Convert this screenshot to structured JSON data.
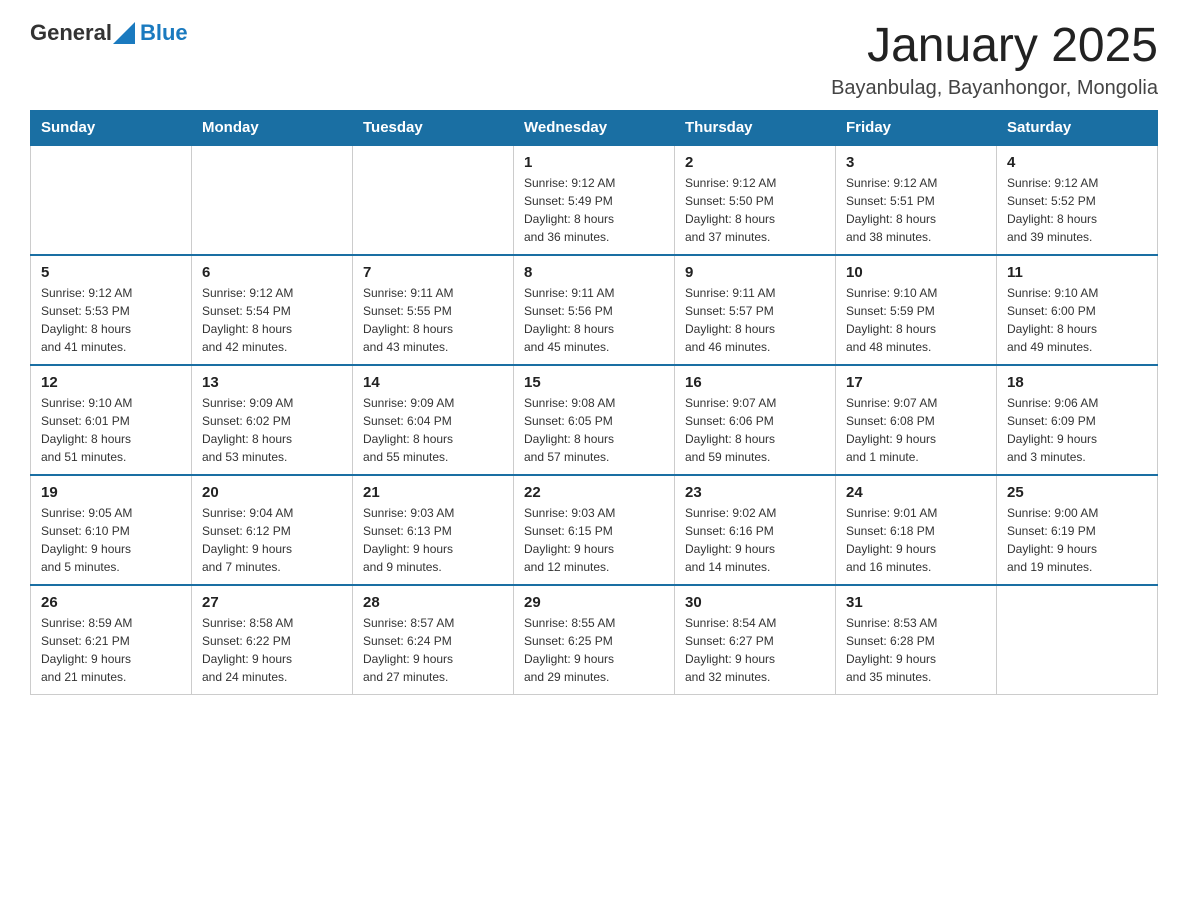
{
  "logo": {
    "text_general": "General",
    "text_blue": "Blue"
  },
  "header": {
    "month_title": "January 2025",
    "location": "Bayanbulag, Bayanhongor, Mongolia"
  },
  "days_of_week": [
    "Sunday",
    "Monday",
    "Tuesday",
    "Wednesday",
    "Thursday",
    "Friday",
    "Saturday"
  ],
  "weeks": [
    [
      {
        "day": "",
        "info": ""
      },
      {
        "day": "",
        "info": ""
      },
      {
        "day": "",
        "info": ""
      },
      {
        "day": "1",
        "info": "Sunrise: 9:12 AM\nSunset: 5:49 PM\nDaylight: 8 hours\nand 36 minutes."
      },
      {
        "day": "2",
        "info": "Sunrise: 9:12 AM\nSunset: 5:50 PM\nDaylight: 8 hours\nand 37 minutes."
      },
      {
        "day": "3",
        "info": "Sunrise: 9:12 AM\nSunset: 5:51 PM\nDaylight: 8 hours\nand 38 minutes."
      },
      {
        "day": "4",
        "info": "Sunrise: 9:12 AM\nSunset: 5:52 PM\nDaylight: 8 hours\nand 39 minutes."
      }
    ],
    [
      {
        "day": "5",
        "info": "Sunrise: 9:12 AM\nSunset: 5:53 PM\nDaylight: 8 hours\nand 41 minutes."
      },
      {
        "day": "6",
        "info": "Sunrise: 9:12 AM\nSunset: 5:54 PM\nDaylight: 8 hours\nand 42 minutes."
      },
      {
        "day": "7",
        "info": "Sunrise: 9:11 AM\nSunset: 5:55 PM\nDaylight: 8 hours\nand 43 minutes."
      },
      {
        "day": "8",
        "info": "Sunrise: 9:11 AM\nSunset: 5:56 PM\nDaylight: 8 hours\nand 45 minutes."
      },
      {
        "day": "9",
        "info": "Sunrise: 9:11 AM\nSunset: 5:57 PM\nDaylight: 8 hours\nand 46 minutes."
      },
      {
        "day": "10",
        "info": "Sunrise: 9:10 AM\nSunset: 5:59 PM\nDaylight: 8 hours\nand 48 minutes."
      },
      {
        "day": "11",
        "info": "Sunrise: 9:10 AM\nSunset: 6:00 PM\nDaylight: 8 hours\nand 49 minutes."
      }
    ],
    [
      {
        "day": "12",
        "info": "Sunrise: 9:10 AM\nSunset: 6:01 PM\nDaylight: 8 hours\nand 51 minutes."
      },
      {
        "day": "13",
        "info": "Sunrise: 9:09 AM\nSunset: 6:02 PM\nDaylight: 8 hours\nand 53 minutes."
      },
      {
        "day": "14",
        "info": "Sunrise: 9:09 AM\nSunset: 6:04 PM\nDaylight: 8 hours\nand 55 minutes."
      },
      {
        "day": "15",
        "info": "Sunrise: 9:08 AM\nSunset: 6:05 PM\nDaylight: 8 hours\nand 57 minutes."
      },
      {
        "day": "16",
        "info": "Sunrise: 9:07 AM\nSunset: 6:06 PM\nDaylight: 8 hours\nand 59 minutes."
      },
      {
        "day": "17",
        "info": "Sunrise: 9:07 AM\nSunset: 6:08 PM\nDaylight: 9 hours\nand 1 minute."
      },
      {
        "day": "18",
        "info": "Sunrise: 9:06 AM\nSunset: 6:09 PM\nDaylight: 9 hours\nand 3 minutes."
      }
    ],
    [
      {
        "day": "19",
        "info": "Sunrise: 9:05 AM\nSunset: 6:10 PM\nDaylight: 9 hours\nand 5 minutes."
      },
      {
        "day": "20",
        "info": "Sunrise: 9:04 AM\nSunset: 6:12 PM\nDaylight: 9 hours\nand 7 minutes."
      },
      {
        "day": "21",
        "info": "Sunrise: 9:03 AM\nSunset: 6:13 PM\nDaylight: 9 hours\nand 9 minutes."
      },
      {
        "day": "22",
        "info": "Sunrise: 9:03 AM\nSunset: 6:15 PM\nDaylight: 9 hours\nand 12 minutes."
      },
      {
        "day": "23",
        "info": "Sunrise: 9:02 AM\nSunset: 6:16 PM\nDaylight: 9 hours\nand 14 minutes."
      },
      {
        "day": "24",
        "info": "Sunrise: 9:01 AM\nSunset: 6:18 PM\nDaylight: 9 hours\nand 16 minutes."
      },
      {
        "day": "25",
        "info": "Sunrise: 9:00 AM\nSunset: 6:19 PM\nDaylight: 9 hours\nand 19 minutes."
      }
    ],
    [
      {
        "day": "26",
        "info": "Sunrise: 8:59 AM\nSunset: 6:21 PM\nDaylight: 9 hours\nand 21 minutes."
      },
      {
        "day": "27",
        "info": "Sunrise: 8:58 AM\nSunset: 6:22 PM\nDaylight: 9 hours\nand 24 minutes."
      },
      {
        "day": "28",
        "info": "Sunrise: 8:57 AM\nSunset: 6:24 PM\nDaylight: 9 hours\nand 27 minutes."
      },
      {
        "day": "29",
        "info": "Sunrise: 8:55 AM\nSunset: 6:25 PM\nDaylight: 9 hours\nand 29 minutes."
      },
      {
        "day": "30",
        "info": "Sunrise: 8:54 AM\nSunset: 6:27 PM\nDaylight: 9 hours\nand 32 minutes."
      },
      {
        "day": "31",
        "info": "Sunrise: 8:53 AM\nSunset: 6:28 PM\nDaylight: 9 hours\nand 35 minutes."
      },
      {
        "day": "",
        "info": ""
      }
    ]
  ]
}
